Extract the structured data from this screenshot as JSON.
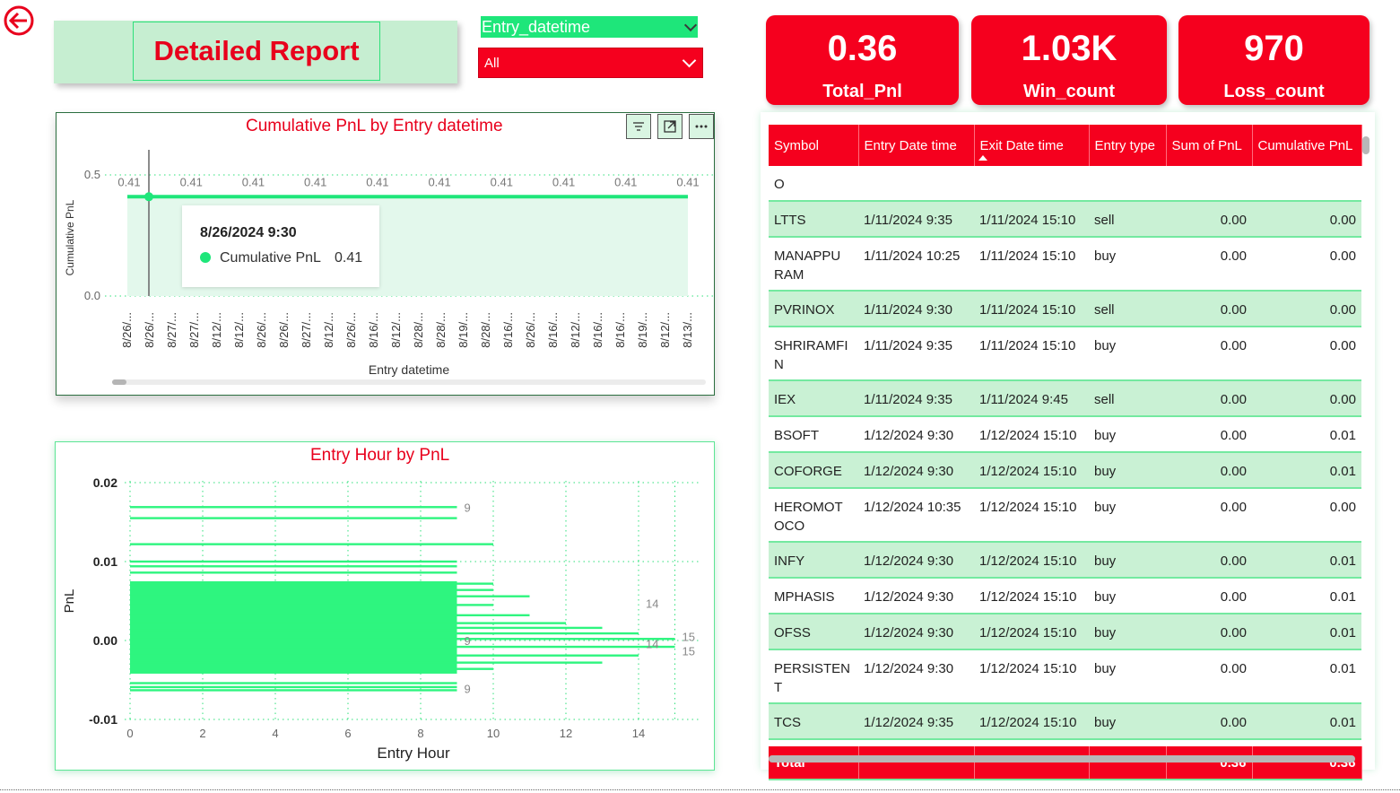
{
  "report": {
    "title": "Detailed Report",
    "back_icon": "arrow-left-circle-icon",
    "accent_red": "#f5001e",
    "accent_green": "#1ee67a"
  },
  "slicer": {
    "field_label": "Entry_datetime",
    "value": "All"
  },
  "kpis": [
    {
      "value": "0.36",
      "label": "Total_Pnl"
    },
    {
      "value": "1.03K",
      "label": "Win_count"
    },
    {
      "value": "970",
      "label": "Loss_count"
    }
  ],
  "line_chart": {
    "title": "Cumulative PnL by Entry datetime",
    "toolbar_icons": [
      "filter-icon",
      "focus-mode-icon",
      "more-options-icon"
    ],
    "chart_data": {
      "type": "line",
      "title": "Cumulative PnL by Entry datetime",
      "xlabel": "Entry datetime",
      "ylabel": "Cumulative PnL",
      "ylim": [
        0.0,
        0.5
      ],
      "yticks": [
        "0.5",
        "0.0"
      ],
      "categories": [
        "8/26/...",
        "8/26/...",
        "8/27/...",
        "8/27/...",
        "8/12/...",
        "8/12/...",
        "8/26/...",
        "8/26/...",
        "8/27/...",
        "8/12/...",
        "8/26/...",
        "8/16/...",
        "8/12/...",
        "8/28/...",
        "8/28/...",
        "8/19/...",
        "8/28/...",
        "8/16/...",
        "8/26/...",
        "8/16/...",
        "8/12/...",
        "8/16/...",
        "8/16/...",
        "8/19/...",
        "8/12/...",
        "8/13/..."
      ],
      "series": [
        {
          "name": "Cumulative PnL",
          "values": [
            0.41,
            0.41,
            0.41,
            0.41,
            0.41,
            0.41,
            0.41,
            0.41,
            0.41,
            0.41,
            0.41,
            0.41,
            0.41,
            0.41,
            0.41,
            0.41,
            0.41,
            0.41,
            0.41,
            0.41,
            0.41,
            0.41,
            0.41,
            0.41,
            0.41,
            0.41
          ]
        }
      ],
      "data_labels": [
        "0.41",
        "0.41",
        "0.41",
        "0.41",
        "0.41",
        "0.41",
        "0.41",
        "0.41",
        "0.41",
        "0.41"
      ],
      "grid": true
    },
    "tooltip": {
      "date": "8/26/2024 9:30",
      "series": "Cumulative PnL",
      "value": "0.41"
    }
  },
  "bar_chart": {
    "title": "Entry Hour by PnL",
    "chart_data": {
      "type": "bar",
      "orientation": "horizontal",
      "title": "Entry Hour by PnL",
      "xlabel": "Entry Hour",
      "ylabel": "PnL",
      "xlim": [
        0,
        15
      ],
      "ylim": [
        -0.01,
        0.02
      ],
      "xticks": [
        "0",
        "2",
        "4",
        "6",
        "8",
        "10",
        "12",
        "14"
      ],
      "yticks": [
        "0.02",
        "0.01",
        "0.00",
        "-0.01"
      ],
      "bars": [
        {
          "pnl": 0.0169,
          "hour": 9
        },
        {
          "pnl": 0.0155,
          "hour": 9
        },
        {
          "pnl": 0.0122,
          "hour": 10
        },
        {
          "pnl": 0.01,
          "hour": 9
        },
        {
          "pnl": 0.0094,
          "hour": 9
        },
        {
          "pnl": 0.0086,
          "hour": 9
        },
        {
          "pnl": 0.0072,
          "hour": 10
        },
        {
          "pnl": 0.0064,
          "hour": 10
        },
        {
          "pnl": 0.0056,
          "hour": 11
        },
        {
          "pnl": 0.0045,
          "hour": 10
        },
        {
          "pnl": 0.0032,
          "hour": 11
        },
        {
          "pnl": 0.0022,
          "hour": 12
        },
        {
          "pnl": 0.0016,
          "hour": 13
        },
        {
          "pnl": 0.0009,
          "hour": 14
        },
        {
          "pnl": 0.0002,
          "hour": 15
        },
        {
          "pnl": -0.0008,
          "hour": 15
        },
        {
          "pnl": -0.0019,
          "hour": 14
        },
        {
          "pnl": -0.0028,
          "hour": 13
        },
        {
          "pnl": -0.0036,
          "hour": 10
        },
        {
          "pnl": -0.0054,
          "hour": 9
        },
        {
          "pnl": -0.0059,
          "hour": 9
        },
        {
          "pnl": -0.0063,
          "hour": 9
        }
      ],
      "dense_block": {
        "hour": 9,
        "pnl_from": -0.0042,
        "pnl_to": 0.0075
      },
      "data_labels": [
        {
          "text": "9",
          "pnl": 0.0169,
          "hour": 9
        },
        {
          "text": "14",
          "pnl": 0.0047,
          "hour": 14
        },
        {
          "text": "9",
          "pnl": 0.0,
          "hour": 9
        },
        {
          "text": "14",
          "pnl": -0.0004,
          "hour": 14
        },
        {
          "text": "15",
          "pnl": 0.0005,
          "hour": 15
        },
        {
          "text": "15",
          "pnl": -0.0013,
          "hour": 15
        },
        {
          "text": "9",
          "pnl": -0.0061,
          "hour": 9
        }
      ],
      "grid": true
    }
  },
  "table": {
    "columns": [
      "Symbol",
      "Entry Date time",
      "Exit Date time",
      "Entry type",
      "Sum of PnL",
      "Cumulative PnL"
    ],
    "sorted_column": "Exit Date time",
    "rows": [
      [
        "O",
        "",
        "",
        "",
        "",
        ""
      ],
      [
        "LTTS",
        "1/11/2024 9:35",
        "1/11/2024 15:10",
        "sell",
        "0.00",
        "0.00"
      ],
      [
        "MANAPPU RAM",
        "1/11/2024 10:25",
        "1/11/2024 15:10",
        "buy",
        "0.00",
        "0.00"
      ],
      [
        "PVRINOX",
        "1/11/2024 9:30",
        "1/11/2024 15:10",
        "sell",
        "0.00",
        "0.00"
      ],
      [
        "SHRIRAMFI N",
        "1/11/2024 9:35",
        "1/11/2024 15:10",
        "buy",
        "0.00",
        "0.00"
      ],
      [
        "IEX",
        "1/11/2024 9:35",
        "1/11/2024 9:45",
        "sell",
        "0.00",
        "0.00"
      ],
      [
        "BSOFT",
        "1/12/2024 9:30",
        "1/12/2024 15:10",
        "buy",
        "0.00",
        "0.01"
      ],
      [
        "COFORGE",
        "1/12/2024 9:30",
        "1/12/2024 15:10",
        "buy",
        "0.00",
        "0.01"
      ],
      [
        "HEROMOT OCO",
        "1/12/2024 10:35",
        "1/12/2024 15:10",
        "buy",
        "0.00",
        "0.00"
      ],
      [
        "INFY",
        "1/12/2024 9:30",
        "1/12/2024 15:10",
        "buy",
        "0.00",
        "0.01"
      ],
      [
        "MPHASIS",
        "1/12/2024 9:30",
        "1/12/2024 15:10",
        "buy",
        "0.00",
        "0.01"
      ],
      [
        "OFSS",
        "1/12/2024 9:30",
        "1/12/2024 15:10",
        "buy",
        "0.00",
        "0.01"
      ],
      [
        "PERSISTEN T",
        "1/12/2024 9:30",
        "1/12/2024 15:10",
        "buy",
        "0.00",
        "0.01"
      ],
      [
        "TCS",
        "1/12/2024 9:35",
        "1/12/2024 15:10",
        "buy",
        "0.00",
        "0.01"
      ]
    ],
    "total": {
      "label": "Total",
      "sum_pnl": "0.36",
      "cumulative_pnl": "0.36"
    }
  }
}
